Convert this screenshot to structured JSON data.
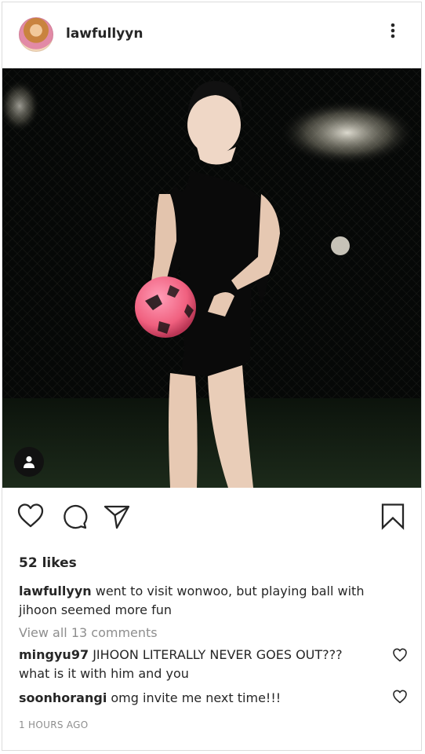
{
  "post": {
    "username": "lawfullyyn",
    "likes": "52 likes",
    "caption_username": "lawfullyyn",
    "caption_text": "went to visit wonwoo, but playing ball with jihoon seemed more fun",
    "view_all": "View all 13 comments",
    "comments": [
      {
        "username": "mingyu97",
        "text": "JIHOON LITERALLY NEVER GOES OUT??? what is it with him and you"
      },
      {
        "username": "soonhorangi",
        "text": "omg invite me next time!!!"
      }
    ],
    "timestamp": "1 HOURS AGO"
  },
  "icons": {
    "more": "more-vertical-icon",
    "like": "heart-icon",
    "comment": "comment-icon",
    "share": "send-icon",
    "save": "bookmark-icon",
    "tag": "user-tag-icon"
  }
}
